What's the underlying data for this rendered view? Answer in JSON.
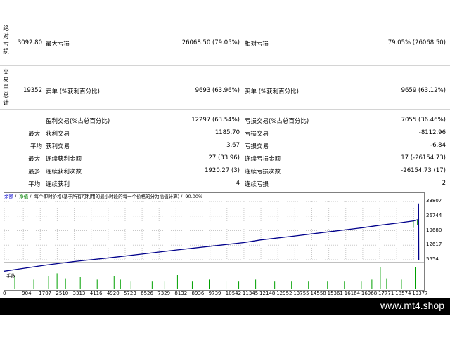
{
  "section_labels": {
    "absolute": [
      "绝",
      "对",
      "亏",
      "损"
    ],
    "trades": [
      "交",
      "易",
      "单",
      "总",
      "计"
    ]
  },
  "rows": {
    "r1": {
      "c1": "3092.80",
      "l2": "最大亏损",
      "v2": "26068.50 (79.05%)",
      "l3": "相对亏损",
      "v3": "79.05% (26068.50)"
    },
    "r2": {
      "c1": "19352",
      "l2": "卖单 (%获利百分比)",
      "v2": "9693 (63.96%)",
      "l3": "买单 (%获利百分比)",
      "v3": "9659 (63.12%)"
    },
    "r3": {
      "l2": "盈利交易(%占总百分比)",
      "v2": "12297 (63.54%)",
      "l3": "亏损交易(%占总百分比)",
      "v3": "7055 (36.46%)"
    },
    "r4": {
      "k": "最大:",
      "l2": "获利交易",
      "v2": "1185.70",
      "l3": "亏损交易",
      "v3": "-8112.96"
    },
    "r5": {
      "k": "平均",
      "l2": "获利交易",
      "v2": "3.67",
      "l3": "亏损交易",
      "v3": "-6.84"
    },
    "r6": {
      "k": "最大:",
      "l2": "连续获利金额",
      "v2": "27 (33.96)",
      "l3": "连续亏损金额",
      "v3": "17 (-26154.73)"
    },
    "r7": {
      "k": "最多:",
      "l2": "连续获利次数",
      "v2": "1920.27 (3)",
      "l3": "连续亏损次数",
      "v3": "-26154.73 (17)"
    },
    "r8": {
      "k": "平均:",
      "l2": "连续获利",
      "v2": "4",
      "l3": "连续亏损",
      "v3": "2"
    }
  },
  "chart_header": {
    "balance": "余额",
    "equity": "净值",
    "model": "每个即时价格(基于所有可利用的最小时段的每一个价格的分为插值计算)",
    "quality": "90.00%"
  },
  "volume_label": "手数",
  "colors": {
    "balance": "#00008b",
    "equity": "#008000",
    "volume": "#00a000",
    "balance_label": "#0000cc",
    "equity_label": "#008000"
  },
  "chart_data": {
    "type": "line",
    "x": [
      0,
      1000,
      2000,
      3313,
      5000,
      6526,
      8000,
      9739,
      11345,
      12148,
      13755,
      15361,
      16968,
      17771,
      18574,
      19377,
      19600,
      19610,
      19620
    ],
    "series": [
      {
        "values": [
          0,
          1500,
          3000,
          4700,
          6500,
          8300,
          10100,
          12100,
          13900,
          15200,
          17100,
          19100,
          21100,
          22300,
          23300,
          24400,
          25100,
          32900,
          5554
        ]
      }
    ],
    "y_ticks": [
      "33807",
      "26744",
      "19680",
      "12617",
      "5554"
    ],
    "x_ticks": [
      "0",
      "904",
      "1707",
      "2510",
      "3313",
      "4116",
      "4920",
      "5723",
      "6526",
      "7329",
      "8132",
      "8936",
      "9739",
      "10542",
      "11345",
      "12148",
      "12952",
      "13755",
      "14558",
      "15361",
      "16164",
      "16968",
      "17771",
      "18574",
      "19377"
    ],
    "ylim": [
      5554,
      33807
    ],
    "xlim": [
      0,
      19700
    ],
    "volume": [
      {
        "x": 500,
        "v": 0.5
      },
      {
        "x": 1400,
        "v": 0.35
      },
      {
        "x": 2100,
        "v": 0.5
      },
      {
        "x": 2500,
        "v": 0.6
      },
      {
        "x": 2900,
        "v": 0.4
      },
      {
        "x": 3600,
        "v": 0.45
      },
      {
        "x": 4400,
        "v": 0.35
      },
      {
        "x": 5200,
        "v": 0.5
      },
      {
        "x": 5500,
        "v": 0.35
      },
      {
        "x": 6000,
        "v": 0.3
      },
      {
        "x": 7000,
        "v": 0.3
      },
      {
        "x": 7600,
        "v": 0.3
      },
      {
        "x": 8200,
        "v": 0.55
      },
      {
        "x": 8900,
        "v": 0.3
      },
      {
        "x": 9700,
        "v": 0.35
      },
      {
        "x": 10500,
        "v": 0.3
      },
      {
        "x": 11100,
        "v": 0.3
      },
      {
        "x": 11900,
        "v": 0.35
      },
      {
        "x": 12800,
        "v": 0.3
      },
      {
        "x": 13600,
        "v": 0.3
      },
      {
        "x": 14400,
        "v": 0.3
      },
      {
        "x": 15300,
        "v": 0.3
      },
      {
        "x": 16100,
        "v": 0.3
      },
      {
        "x": 16900,
        "v": 0.3
      },
      {
        "x": 17400,
        "v": 0.35
      },
      {
        "x": 17800,
        "v": 0.85
      },
      {
        "x": 18100,
        "v": 0.4
      },
      {
        "x": 18800,
        "v": 0.35
      },
      {
        "x": 19350,
        "v": 0.9
      },
      {
        "x": 19450,
        "v": 0.85
      }
    ]
  },
  "footer_text": "www.mt4.shop"
}
